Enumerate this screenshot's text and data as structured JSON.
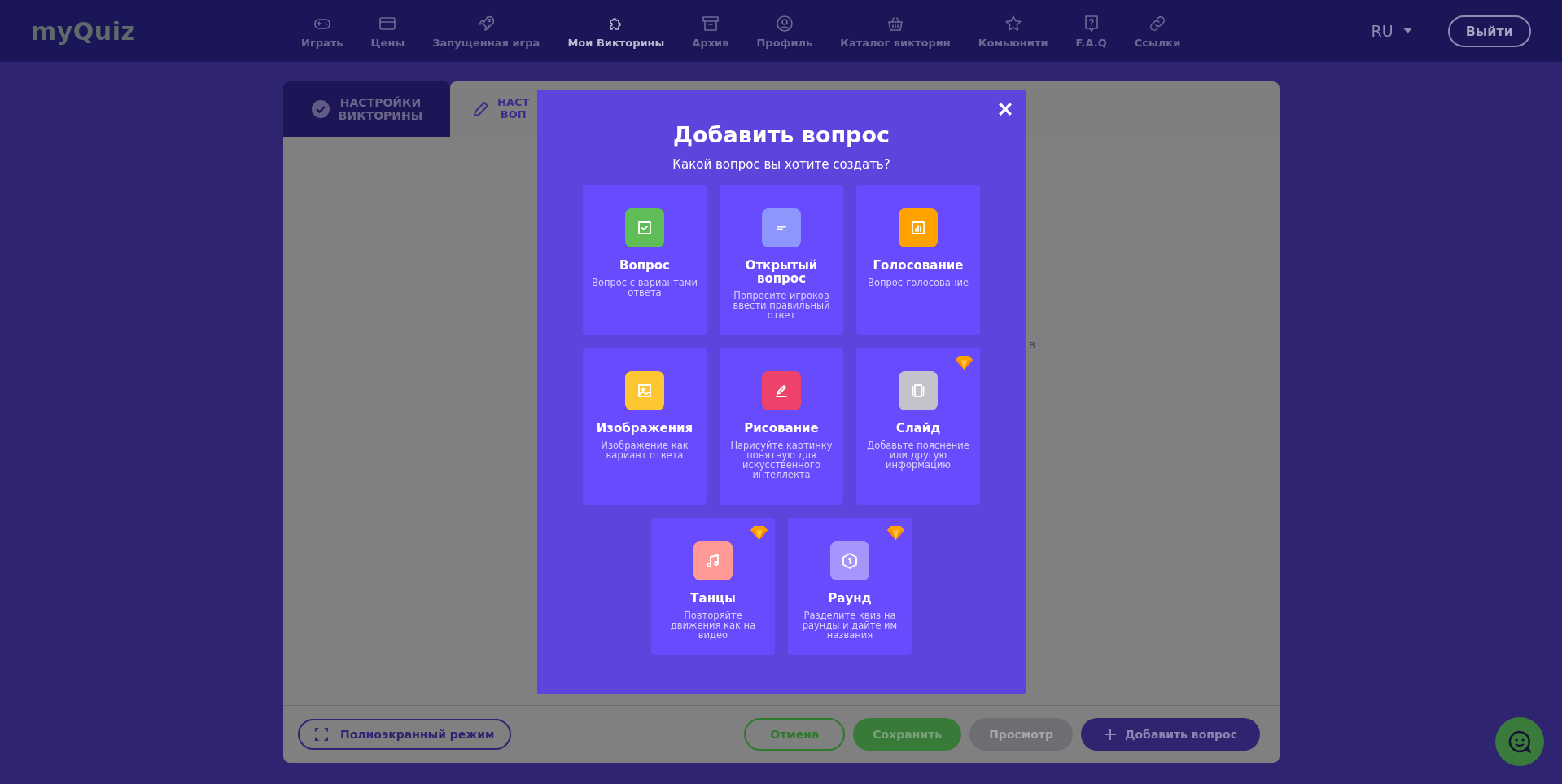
{
  "header": {
    "logo": "myQuiz",
    "nav": [
      {
        "label": "Играть",
        "selected": false
      },
      {
        "label": "Цены",
        "selected": false
      },
      {
        "label": "Запущенная игра",
        "selected": false
      },
      {
        "label": "Мои Викторины",
        "selected": true
      },
      {
        "label": "Архив",
        "selected": false
      },
      {
        "label": "Профиль",
        "selected": false
      },
      {
        "label": "Каталог викторин",
        "selected": false
      },
      {
        "label": "Комьюнити",
        "selected": false
      },
      {
        "label": "F.A.Q",
        "selected": false
      },
      {
        "label": "Ссылки",
        "selected": false
      }
    ],
    "language": "RU",
    "logout": "Выйти"
  },
  "tabs": [
    {
      "lines": [
        "НАСТРОЙКИ",
        "ВИКТОРИНЫ"
      ],
      "selected": true
    },
    {
      "lines": [
        "НАСТ",
        "ВОП"
      ],
      "selected": false
    }
  ],
  "background_text": "в",
  "modal": {
    "title": "Добавить вопрос",
    "subtitle": "Какой вопрос вы хотите создать?",
    "cards": [
      {
        "title": "Вопрос",
        "description": "Вопрос с вариантами ответа",
        "color": "#5fbd58",
        "premium": false
      },
      {
        "title": "Открытый вопрос",
        "description": "Попросите игроков ввести правильный ответ",
        "color": "#8c96fc",
        "premium": false
      },
      {
        "title": "Голосование",
        "description": "Вопрос-голосование",
        "color": "#ffa200",
        "premium": false
      },
      {
        "title": "Изображения",
        "description": "Изображение как вариант ответа",
        "color": "#ffc634",
        "premium": false
      },
      {
        "title": "Рисование",
        "description": "Нарисуйте картинку понятную для искусственного интеллекта",
        "color": "#ef426a",
        "premium": false
      },
      {
        "title": "Слайд",
        "description": "Добавьте пояснение или другую информацию",
        "color": "#c3c3cc",
        "premium": true
      },
      {
        "title": "Танцы",
        "description": "Повторяйте движения как на видео",
        "color": "#ff9a96",
        "premium": true
      },
      {
        "title": "Раунд",
        "description": "Разделите квиз на раунды и дайте им названия",
        "color": "#a596fd",
        "premium": true
      }
    ]
  },
  "footer": {
    "fullscreen": "Полноэкранный режим",
    "buttons": [
      {
        "label": "Отмена",
        "kind": "outline",
        "disabled": false
      },
      {
        "label": "Сохранить",
        "kind": "filled",
        "disabled": false
      },
      {
        "label": "Просмотр",
        "kind": "filled",
        "disabled": true
      },
      {
        "label": "Добавить вопрос",
        "kind": "primary",
        "disabled": false
      }
    ]
  }
}
